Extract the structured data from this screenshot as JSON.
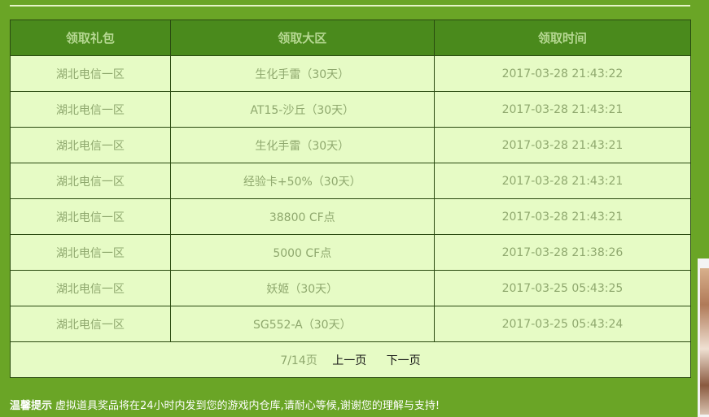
{
  "table": {
    "headers": [
      "领取礼包",
      "领取大区",
      "领取时间"
    ],
    "rows": [
      [
        "湖北电信一区",
        "生化手雷（30天）",
        "2017-03-28 21:43:22"
      ],
      [
        "湖北电信一区",
        "AT15-沙丘（30天）",
        "2017-03-28 21:43:21"
      ],
      [
        "湖北电信一区",
        "生化手雷（30天）",
        "2017-03-28 21:43:21"
      ],
      [
        "湖北电信一区",
        "经验卡+50%（30天）",
        "2017-03-28 21:43:21"
      ],
      [
        "湖北电信一区",
        "38800 CF点",
        "2017-03-28 21:43:21"
      ],
      [
        "湖北电信一区",
        "5000 CF点",
        "2017-03-28 21:38:26"
      ],
      [
        "湖北电信一区",
        "妖姬（30天）",
        "2017-03-25 05:43:25"
      ],
      [
        "湖北电信一区",
        "SG552-A（30天）",
        "2017-03-25 05:43:24"
      ]
    ]
  },
  "pager": {
    "info": "7/14页",
    "prev": "上一页",
    "next": "下一页"
  },
  "tip": {
    "label": "温馨提示",
    "text": "虚拟道具奖品将在24小时内发到您的游戏内仓库,请耐心等候,谢谢您的理解与支持!"
  }
}
